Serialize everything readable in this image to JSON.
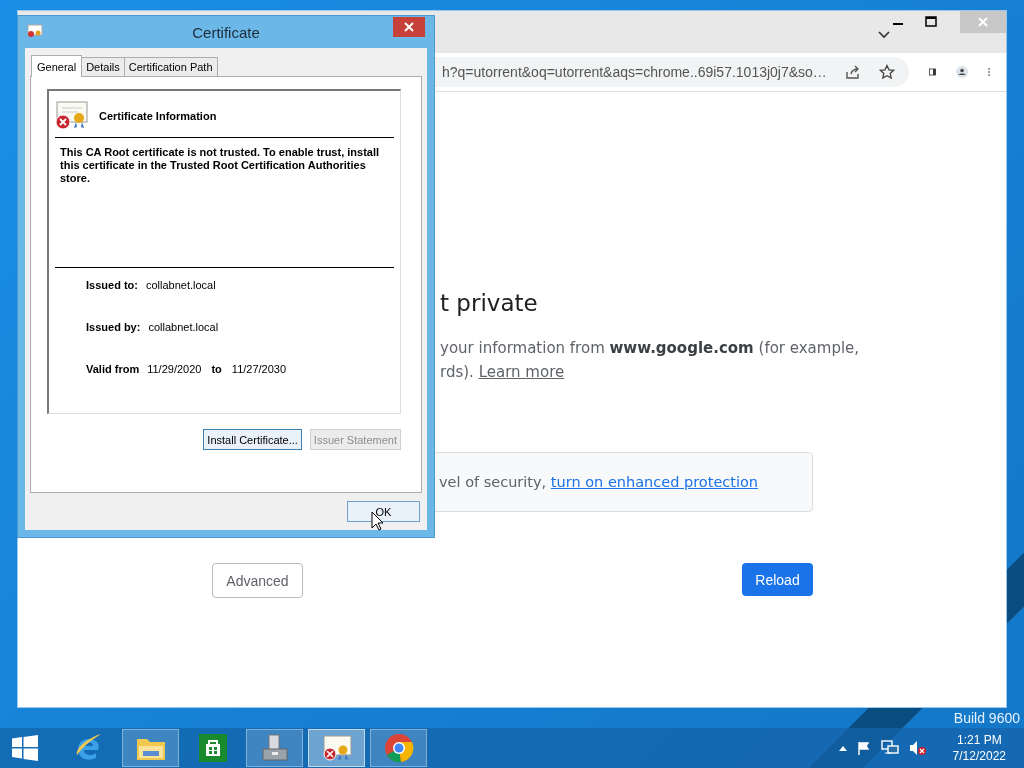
{
  "desktop": {
    "build_text": "Build 9600"
  },
  "browser": {
    "address": "h?q=utorrent&oq=utorrent&aqs=chrome..69i57.1013j0j7&so…",
    "heading": "t private",
    "paragraph_line_1": "your information from **www.google.com** (for example,",
    "paragraph_line_2": "rds).",
    "learn_more_link": "Learn more",
    "protection_text": "vel of security,",
    "protection_link": "turn on enhanced protection",
    "advanced_button": "Advanced",
    "reload_button": "Reload"
  },
  "certificate_dialog": {
    "title": "Certificate",
    "tabs": [
      {
        "label": "General",
        "selected": true
      },
      {
        "label": "Details",
        "selected": false
      },
      {
        "label": "Certification Path",
        "selected": false
      }
    ],
    "heading": "Certificate Information",
    "message": "This CA Root certificate is not trusted. To enable trust, install this certificate in the Trusted Root Certification Authorities store.",
    "fields": [
      {
        "label": "Issued to:",
        "value": "collabnet.local"
      },
      {
        "label": "Issued by:",
        "value": "collabnet.local"
      }
    ],
    "validity": {
      "label": "Valid from",
      "from": "11/29/2020",
      "separator": "to",
      "to": "11/27/2030"
    },
    "buttons": [
      {
        "label": "Install Certificate...",
        "disabled": false
      },
      {
        "label": "Issuer Statement",
        "disabled": true
      }
    ],
    "ok_button": "OK"
  },
  "taskbar": {
    "apps": [
      {
        "kind": "ie",
        "running": false,
        "selected": false
      },
      {
        "kind": "explorer",
        "running": true,
        "selected": false
      },
      {
        "kind": "store",
        "running": false,
        "selected": false
      },
      {
        "kind": "server",
        "running": true,
        "selected": false
      },
      {
        "kind": "certificate",
        "running": true,
        "selected": true
      },
      {
        "kind": "chrome",
        "running": true,
        "selected": false
      }
    ],
    "time": "1:21 PM",
    "date": "7/12/2022"
  }
}
